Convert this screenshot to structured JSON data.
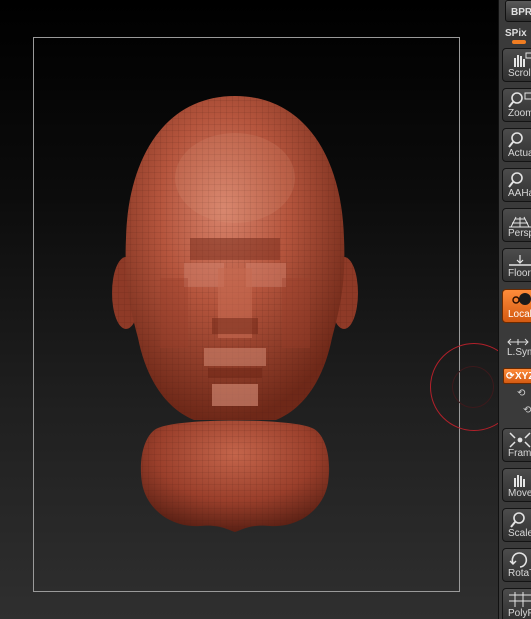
{
  "shelf": {
    "top_button": "BPR",
    "spix_label": "SPix",
    "tools": [
      {
        "label": "Scroll",
        "icon": "hand-scroll-icon"
      },
      {
        "label": "Zoom",
        "icon": "zoom-icon"
      },
      {
        "label": "Actual",
        "icon": "actual-size-icon"
      },
      {
        "label": "AAHalf",
        "icon": "aahalf-icon"
      },
      {
        "label": "Persp",
        "icon": "perspective-grid-icon"
      },
      {
        "label": "Floor",
        "icon": "floor-icon"
      },
      {
        "label": "Local",
        "icon": "local-transform-icon",
        "active": true
      },
      {
        "label": "Frame",
        "icon": "frame-icon"
      },
      {
        "label": "Move",
        "icon": "move-hand-icon"
      },
      {
        "label": "Scale",
        "icon": "scale-icon"
      },
      {
        "label": "RotaT",
        "icon": "rotate-icon"
      },
      {
        "label": "PolyF",
        "icon": "polyframe-icon"
      }
    ],
    "lsym_label": "L.Sym",
    "xyz_label": "XYZ"
  },
  "colors": {
    "accent": "#f07d22",
    "model_base": "#a84a36",
    "gyro": "#b2202a"
  }
}
